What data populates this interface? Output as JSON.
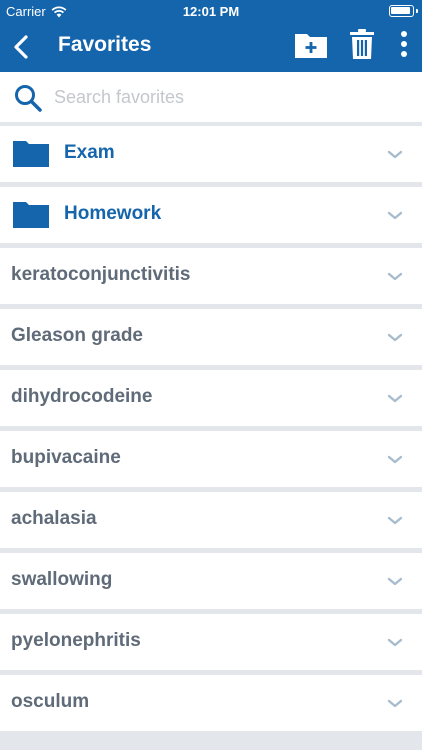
{
  "status_bar": {
    "carrier": "Carrier",
    "time": "12:01 PM"
  },
  "nav": {
    "title": "Favorites",
    "icons": [
      "back-icon",
      "new-folder-icon",
      "trash-icon",
      "more-icon"
    ]
  },
  "search": {
    "placeholder": "Search favorites",
    "value": ""
  },
  "folders": [
    {
      "label": "Exam"
    },
    {
      "label": "Homework"
    }
  ],
  "items": [
    {
      "label": "keratoconjunctivitis"
    },
    {
      "label": "Gleason grade"
    },
    {
      "label": "dihydrocodeine"
    },
    {
      "label": "bupivacaine"
    },
    {
      "label": "achalasia"
    },
    {
      "label": "swallowing"
    },
    {
      "label": "pyelonephritis"
    },
    {
      "label": "osculum"
    }
  ],
  "colors": {
    "primary": "#1565ad",
    "item_text": "#5f6b78",
    "chevron": "#a9bccd",
    "background": "#e3e6ea",
    "placeholder": "#c4c7cc"
  }
}
